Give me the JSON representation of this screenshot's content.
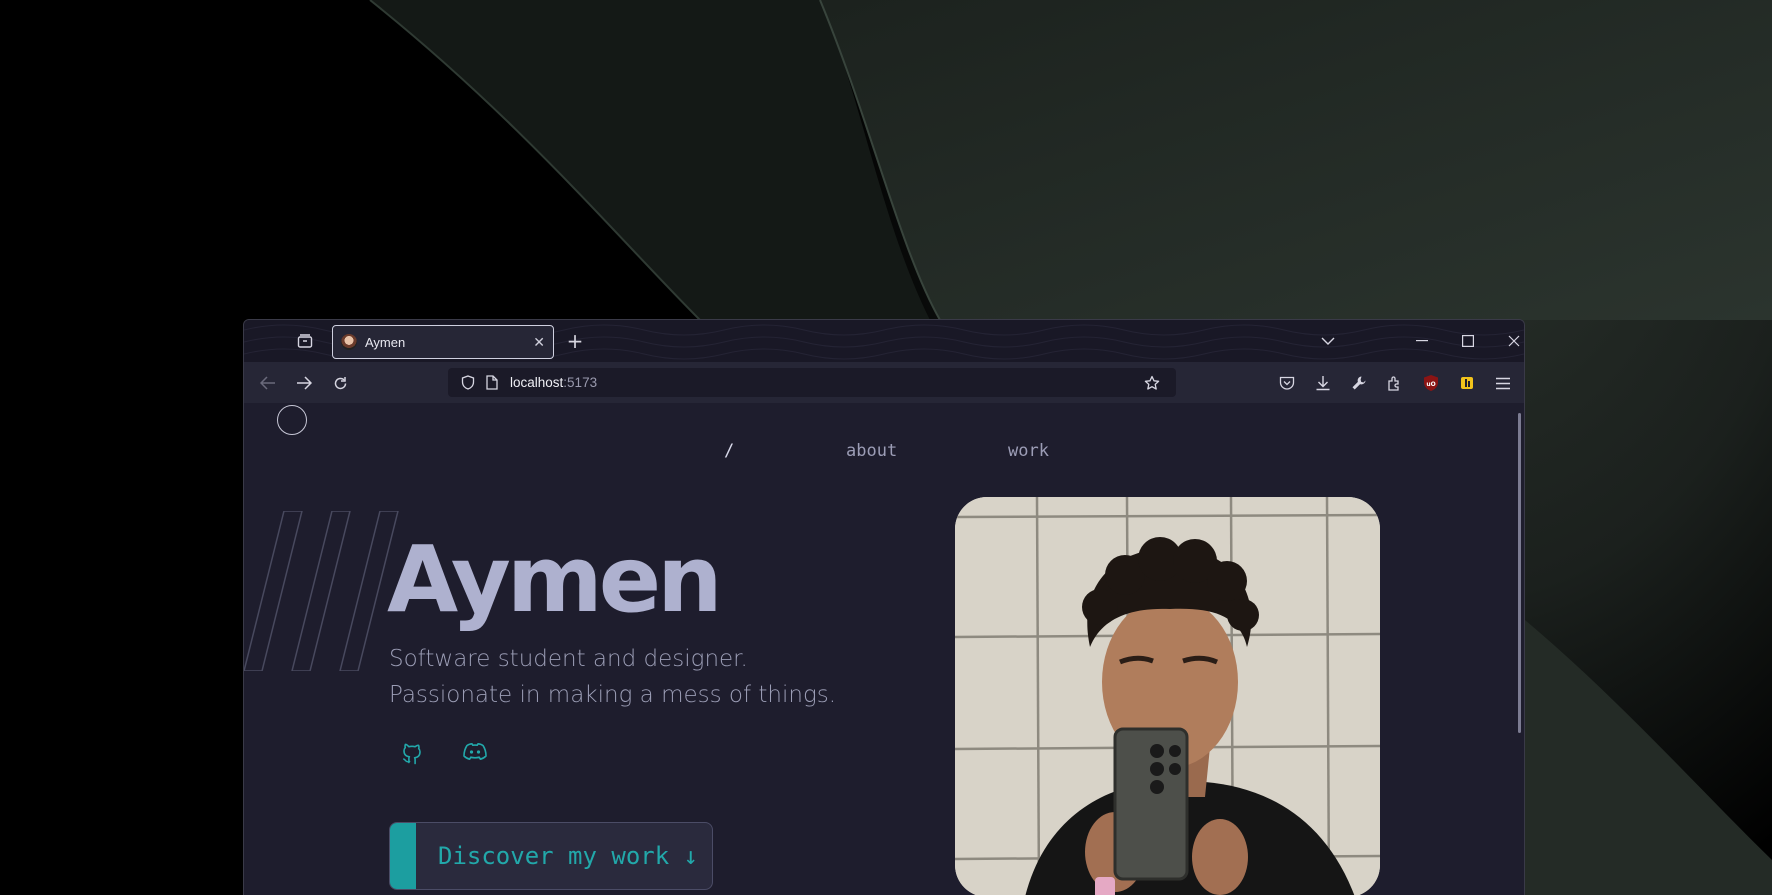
{
  "browser": {
    "tab_title": "Aymen",
    "url_host": "localhost",
    "url_port": ":5173"
  },
  "site": {
    "nav": {
      "home": "/",
      "about": "about",
      "work": "work"
    },
    "hero_name": "Aymen",
    "hero_line1": "Software student and designer.",
    "hero_line2": "Passionate in making a mess of things.",
    "cta_label": "Discover my work ↓",
    "social_icons": [
      "github-icon",
      "discord-icon"
    ]
  },
  "colors": {
    "page_bg": "#1e1d2d",
    "accent": "#1c9ea0",
    "name_color": "#aeb1cf"
  }
}
